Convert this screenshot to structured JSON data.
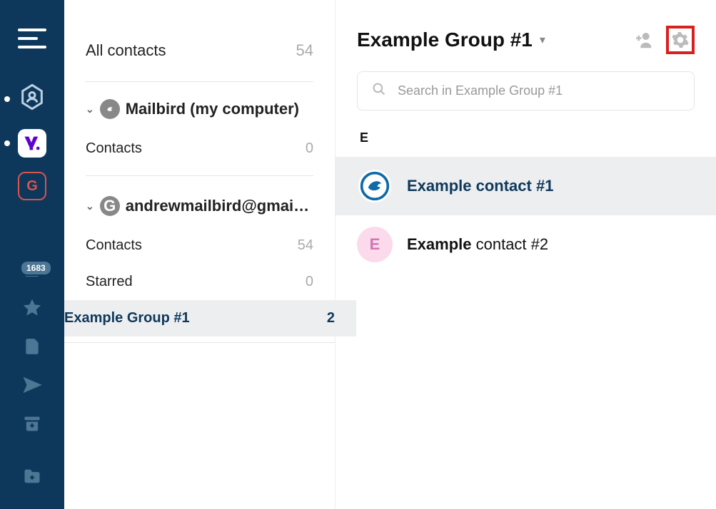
{
  "rail": {
    "badge_count": "1683"
  },
  "sidebar": {
    "all_contacts_label": "All contacts",
    "all_contacts_count": "54",
    "accounts": [
      {
        "name": "Mailbird (my computer)",
        "folders": [
          {
            "label": "Contacts",
            "count": "0"
          }
        ]
      },
      {
        "name": "andrewmailbird@gmail....",
        "folders": [
          {
            "label": "Contacts",
            "count": "54"
          },
          {
            "label": "Starred",
            "count": "0"
          },
          {
            "label": "Example Group #1",
            "count": "2"
          }
        ]
      }
    ]
  },
  "main": {
    "group_title": "Example Group #1",
    "search_placeholder": "Search in Example Group #1",
    "section_letter": "E",
    "contacts": [
      {
        "name_bold": "Example contact #1",
        "name_rest": "",
        "initial": "",
        "avatar_type": "bird"
      },
      {
        "name_bold": "Example",
        "name_rest": " contact #2",
        "initial": "E",
        "avatar_type": "pink"
      }
    ]
  }
}
